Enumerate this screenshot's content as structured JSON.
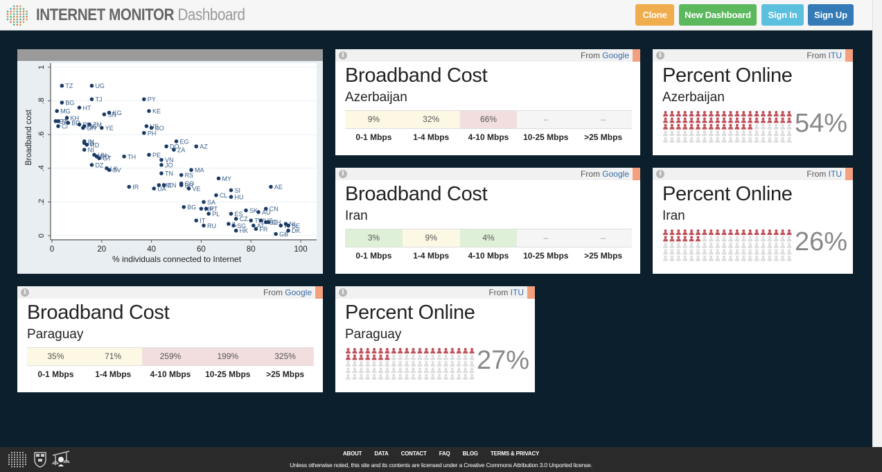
{
  "header": {
    "brand_bold": "INTERNET MONITOR",
    "brand_light": "Dashboard",
    "buttons": {
      "clone": "Clone",
      "new_dashboard": "New Dashboard",
      "sign_in": "Sign In",
      "sign_up": "Sign Up"
    }
  },
  "colors": {
    "clone": "#f0ad4e",
    "new_dashboard": "#5cb85c",
    "sign_in": "#5bc0de",
    "sign_up": "#337ab7",
    "online_filled": "#c0505a",
    "online_empty": "#dcdcdc",
    "background": "#0b1f2c",
    "corner_tab": "#f4a07f"
  },
  "cards": {
    "cost_az": {
      "source_prefix": "From",
      "source_name": "Google",
      "title": "Broadband Cost",
      "country": "Azerbaijan",
      "tiers": [
        {
          "label": "0-1 Mbps",
          "value": "9%",
          "level": "yellow"
        },
        {
          "label": "1-4 Mbps",
          "value": "32%",
          "level": "yellow"
        },
        {
          "label": "4-10 Mbps",
          "value": "66%",
          "level": "red"
        },
        {
          "label": "10-25 Mbps",
          "value": "–",
          "level": "grey"
        },
        {
          "label": ">25 Mbps",
          "value": "–",
          "level": "grey"
        }
      ]
    },
    "cost_ir": {
      "source_prefix": "From",
      "source_name": "Google",
      "title": "Broadband Cost",
      "country": "Iran",
      "tiers": [
        {
          "label": "0-1 Mbps",
          "value": "3%",
          "level": "green"
        },
        {
          "label": "1-4 Mbps",
          "value": "9%",
          "level": "yellow"
        },
        {
          "label": "4-10 Mbps",
          "value": "4%",
          "level": "green"
        },
        {
          "label": "10-25 Mbps",
          "value": "–",
          "level": "grey"
        },
        {
          "label": ">25 Mbps",
          "value": "–",
          "level": "grey"
        }
      ]
    },
    "cost_py": {
      "source_prefix": "From",
      "source_name": "Google",
      "title": "Broadband Cost",
      "country": "Paraguay",
      "tiers": [
        {
          "label": "0-1 Mbps",
          "value": "35%",
          "level": "yellow"
        },
        {
          "label": "1-4 Mbps",
          "value": "71%",
          "level": "yellow"
        },
        {
          "label": "4-10 Mbps",
          "value": "259%",
          "level": "red"
        },
        {
          "label": "10-25 Mbps",
          "value": "199%",
          "level": "red"
        },
        {
          "label": ">25 Mbps",
          "value": "325%",
          "level": "red"
        }
      ]
    },
    "online_az": {
      "source_prefix": "From",
      "source_name": "ITU",
      "title": "Percent Online",
      "country": "Azerbaijan",
      "percent": 54,
      "percent_label": "54%"
    },
    "online_ir": {
      "source_prefix": "From",
      "source_name": "ITU",
      "title": "Percent Online",
      "country": "Iran",
      "percent": 26,
      "percent_label": "26%"
    },
    "online_py": {
      "source_prefix": "From",
      "source_name": "ITU",
      "title": "Percent Online",
      "country": "Paraguay",
      "percent": 27,
      "percent_label": "27%"
    }
  },
  "chart_data": {
    "type": "scatter",
    "title": "",
    "xlabel": "% individuals connected to Internet",
    "ylabel": "Broadband cost",
    "xlim": [
      0,
      100
    ],
    "ylim": [
      0,
      1
    ],
    "xticks": [
      0,
      20,
      40,
      60,
      80,
      100
    ],
    "xtick_labels": [
      "0",
      "20",
      "40",
      "60",
      "80",
      "100"
    ],
    "yticks": [
      0,
      0.2,
      0.4,
      0.6,
      0.8,
      1
    ],
    "ytick_labels": [
      "0",
      ".2",
      ".4",
      ".6",
      ".8",
      "1"
    ],
    "grid": true,
    "points": [
      {
        "label": "TZ",
        "x": 4,
        "y": 0.89
      },
      {
        "label": "UG",
        "x": 16,
        "y": 0.89
      },
      {
        "label": "BG",
        "x": 4,
        "y": 0.79
      },
      {
        "label": "TJ",
        "x": 16,
        "y": 0.81
      },
      {
        "label": "PY",
        "x": 37,
        "y": 0.81
      },
      {
        "label": "HT",
        "x": 11,
        "y": 0.76
      },
      {
        "label": "MG",
        "x": 2,
        "y": 0.74
      },
      {
        "label": "KE",
        "x": 39,
        "y": 0.74
      },
      {
        "label": "SN",
        "x": 21,
        "y": 0.72
      },
      {
        "label": "KG",
        "x": 23,
        "y": 0.73
      },
      {
        "label": "KH",
        "x": 6,
        "y": 0.7
      },
      {
        "label": "ET",
        "x": 1.5,
        "y": 0.68
      },
      {
        "label": "ML",
        "x": 2.5,
        "y": 0.68
      },
      {
        "label": "BD",
        "x": 6.5,
        "y": 0.67
      },
      {
        "label": "CI",
        "x": 2.5,
        "y": 0.65
      },
      {
        "label": "PK",
        "x": 11,
        "y": 0.66
      },
      {
        "label": "ZM",
        "x": 15,
        "y": 0.66
      },
      {
        "label": "GH",
        "x": 12.5,
        "y": 0.64
      },
      {
        "label": "NG",
        "x": 13,
        "y": 0.65
      },
      {
        "label": "YE",
        "x": 20,
        "y": 0.64
      },
      {
        "label": "US",
        "x": 38,
        "y": 0.65
      },
      {
        "label": "BO",
        "x": 40,
        "y": 0.64
      },
      {
        "label": "PH",
        "x": 37,
        "y": 0.61
      },
      {
        "label": "IN",
        "x": 13,
        "y": 0.56
      },
      {
        "label": "RD",
        "x": 14,
        "y": 0.54
      },
      {
        "label": "ID",
        "x": 13,
        "y": 0.55
      },
      {
        "label": "NI",
        "x": 13,
        "y": 0.51
      },
      {
        "label": "HN",
        "x": 17,
        "y": 0.48
      },
      {
        "label": "GT",
        "x": 19,
        "y": 0.46
      },
      {
        "label": "BO2",
        "x": 18,
        "y": 0.47
      },
      {
        "label": "TH",
        "x": 29,
        "y": 0.47
      },
      {
        "label": "DZ",
        "x": 16,
        "y": 0.42
      },
      {
        "label": "LK",
        "x": 22,
        "y": 0.4
      },
      {
        "label": "SV",
        "x": 23,
        "y": 0.39
      },
      {
        "label": "EG",
        "x": 50,
        "y": 0.56
      },
      {
        "label": "DO",
        "x": 46,
        "y": 0.53
      },
      {
        "label": "ZA",
        "x": 49,
        "y": 0.51
      },
      {
        "label": "AZ",
        "x": 58,
        "y": 0.53
      },
      {
        "label": "PE",
        "x": 39,
        "y": 0.48
      },
      {
        "label": "VN",
        "x": 44,
        "y": 0.45
      },
      {
        "label": "JO",
        "x": 44,
        "y": 0.42
      },
      {
        "label": "TN",
        "x": 44,
        "y": 0.37
      },
      {
        "label": "MA",
        "x": 56,
        "y": 0.39
      },
      {
        "label": "RS",
        "x": 52,
        "y": 0.36
      },
      {
        "label": "MY",
        "x": 67,
        "y": 0.34
      },
      {
        "label": "IR",
        "x": 31,
        "y": 0.29
      },
      {
        "label": "UA",
        "x": 41,
        "y": 0.28
      },
      {
        "label": "MX",
        "x": 43,
        "y": 0.3
      },
      {
        "label": "CN",
        "x": 45,
        "y": 0.3
      },
      {
        "label": "CO",
        "x": 52,
        "y": 0.31
      },
      {
        "label": "BR",
        "x": 52,
        "y": 0.3
      },
      {
        "label": "VE",
        "x": 55,
        "y": 0.28
      },
      {
        "label": "AE",
        "x": 88,
        "y": 0.29
      },
      {
        "label": "SI",
        "x": 72,
        "y": 0.27
      },
      {
        "label": "CL",
        "x": 66,
        "y": 0.24
      },
      {
        "label": "HU",
        "x": 72,
        "y": 0.23
      },
      {
        "label": "SA",
        "x": 61,
        "y": 0.2
      },
      {
        "label": "BG2",
        "x": 53,
        "y": 0.17
      },
      {
        "label": "HR",
        "x": 60,
        "y": 0.16
      },
      {
        "label": "PT",
        "x": 62,
        "y": 0.16
      },
      {
        "label": "PL",
        "x": 63,
        "y": 0.13
      },
      {
        "label": "SK",
        "x": 78,
        "y": 0.15
      },
      {
        "label": "AU",
        "x": 83,
        "y": 0.14
      },
      {
        "label": "CN2",
        "x": 86,
        "y": 0.16
      },
      {
        "label": "ES",
        "x": 72,
        "y": 0.13
      },
      {
        "label": "IT",
        "x": 58,
        "y": 0.09
      },
      {
        "label": "RU",
        "x": 61,
        "y": 0.06
      },
      {
        "label": "CZ",
        "x": 74,
        "y": 0.1
      },
      {
        "label": "TW",
        "x": 80,
        "y": 0.09
      },
      {
        "label": "US2",
        "x": 84,
        "y": 0.09
      },
      {
        "label": "BE",
        "x": 86,
        "y": 0.08
      },
      {
        "label": "CH",
        "x": 87,
        "y": 0.08
      },
      {
        "label": "SG",
        "x": 73,
        "y": 0.06
      },
      {
        "label": "IL",
        "x": 71,
        "y": 0.07
      },
      {
        "label": "HK",
        "x": 74,
        "y": 0.03
      },
      {
        "label": "AT",
        "x": 81,
        "y": 0.06
      },
      {
        "label": "FR",
        "x": 82,
        "y": 0.04
      },
      {
        "label": "FI",
        "x": 92,
        "y": 0.06
      },
      {
        "label": "NL",
        "x": 94,
        "y": 0.07
      },
      {
        "label": "SE",
        "x": 95,
        "y": 0.06
      },
      {
        "label": "DK",
        "x": 95,
        "y": 0.03
      },
      {
        "label": "GB",
        "x": 90,
        "y": 0.01
      }
    ]
  },
  "footer": {
    "nav": [
      "ABOUT",
      "DATA",
      "CONTACT",
      "FAQ",
      "BLOG",
      "TERMS & PRIVACY"
    ],
    "license": "Unless otherwise noted, this site and its contents are licensed under a Creative Commons Attribution 3.0 Unported license."
  }
}
